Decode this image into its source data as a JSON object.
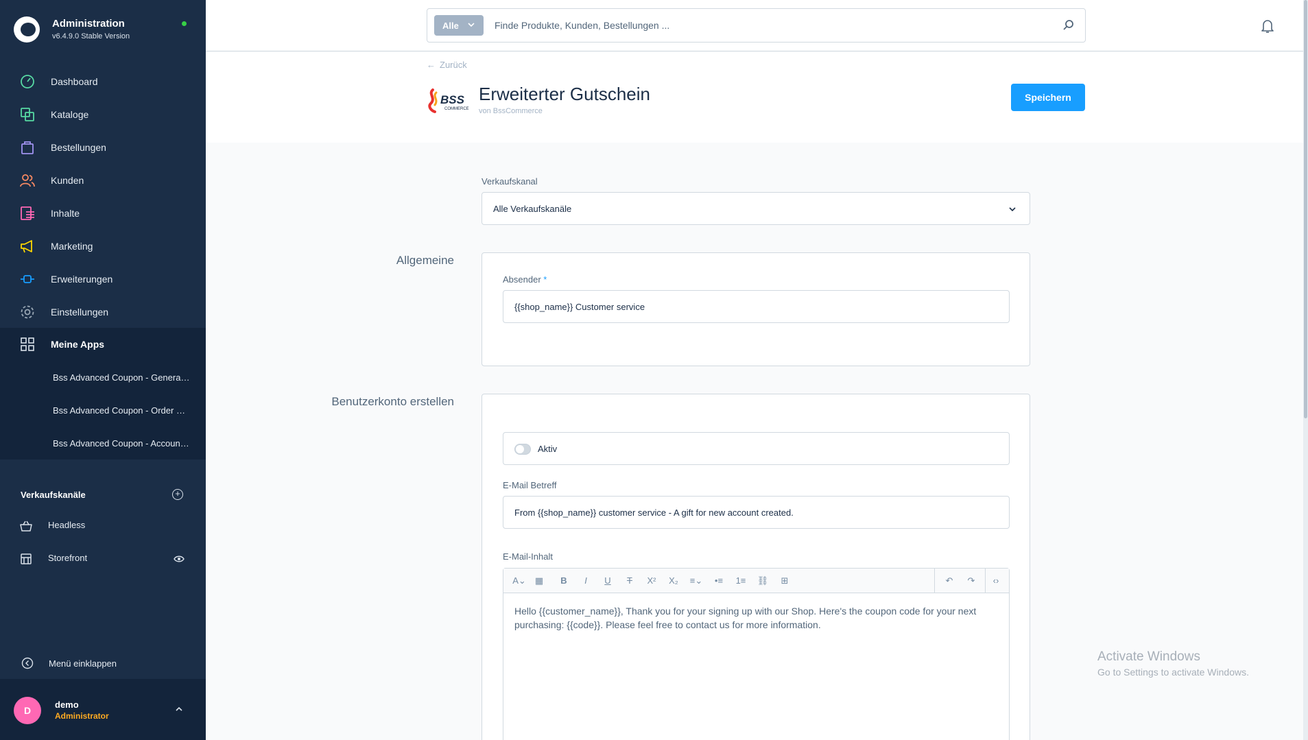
{
  "app": {
    "title": "Administration",
    "version": "v6.4.9.0 Stable Version"
  },
  "sidebar": {
    "items": [
      {
        "label": "Dashboard",
        "icon": "dashboard-icon",
        "color": "#57d9a3"
      },
      {
        "label": "Kataloge",
        "icon": "catalog-icon",
        "color": "#57d9a3"
      },
      {
        "label": "Bestellungen",
        "icon": "shopping-bag-icon",
        "color": "#a092f0"
      },
      {
        "label": "Kunden",
        "icon": "users-icon",
        "color": "#f88962"
      },
      {
        "label": "Inhalte",
        "icon": "content-icon",
        "color": "#ff68b4"
      },
      {
        "label": "Marketing",
        "icon": "megaphone-icon",
        "color": "#ffd700"
      },
      {
        "label": "Erweiterungen",
        "icon": "plug-icon",
        "color": "#189eff"
      },
      {
        "label": "Einstellungen",
        "icon": "gear-icon",
        "color": "#9aa8b5"
      },
      {
        "label": "Meine Apps",
        "icon": "grid-icon",
        "color": "#d9e1ea"
      }
    ],
    "apps": [
      "Bss Advanced Coupon - General Configuration",
      "Bss Advanced Coupon - Order Configuration",
      "Bss Advanced Coupon - Account Configuration"
    ],
    "sales_channels_title": "Verkaufskanäle",
    "sales_channels": [
      {
        "label": "Headless",
        "icon": "basket-icon"
      },
      {
        "label": "Storefront",
        "icon": "storefront-icon"
      }
    ],
    "collapse_label": "Menü einklappen"
  },
  "user": {
    "initial": "D",
    "name": "demo",
    "role": "Administrator"
  },
  "search": {
    "type": "Alle",
    "placeholder": "Finde Produkte, Kunden, Bestellungen ..."
  },
  "header": {
    "back": "Zurück",
    "logo_text": "BSS",
    "logo_sub": "COMMERCE",
    "title": "Erweiterter Gutschein",
    "subtitle": "von BssCommerce",
    "save": "Speichern"
  },
  "form": {
    "sales_channel_label": "Verkaufskanal",
    "sales_channel_value": "Alle Verkaufskanäle",
    "section_general": "Allgemeine",
    "sender_label": "Absender",
    "sender_required": "*",
    "sender_value": "{{shop_name}} Customer service",
    "section_account": "Benutzerkonto erstellen",
    "active_label": "Aktiv",
    "subject_label": "E-Mail Betreff",
    "subject_value": "From {{shop_name}} customer service - A gift for new account created.",
    "content_label": "E-Mail-Inhalt",
    "content_value": "Hello {{customer_name}}, Thank you for your signing up with our Shop. Here's the coupon code for your next purchasing: {{code}}. Please feel free to contact us for more information."
  },
  "watermark": {
    "line1": "Activate Windows",
    "line2": "Go to Settings to activate Windows."
  },
  "colors": {
    "sidebar": "#1b2e47",
    "primary": "#189eff",
    "avatar": "#ff68b4",
    "role": "#ffab22"
  }
}
